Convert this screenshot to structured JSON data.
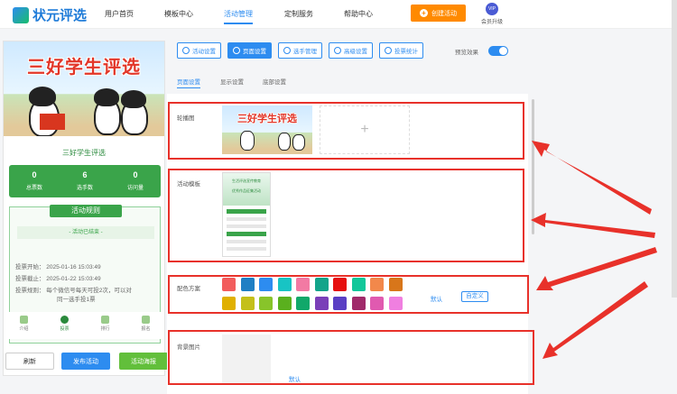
{
  "brand": {
    "name": "状元评选"
  },
  "nav": {
    "items": [
      "用户首页",
      "模板中心",
      "活动管理",
      "定制服务",
      "帮助中心"
    ],
    "active": "活动管理"
  },
  "header": {
    "create_button": "创建活动",
    "vip_badge": "VIP",
    "vip_label": "会员升级"
  },
  "phone": {
    "banner_title": "三好学生评选",
    "activity_name": "三好学生评选",
    "stats": [
      {
        "num": "0",
        "label": "总票数"
      },
      {
        "num": "6",
        "label": "选手数"
      },
      {
        "num": "0",
        "label": "访问量"
      }
    ],
    "rules_title": "活动规则",
    "ended": "- 活动已结束 -",
    "rule_start": "投票开始：  2025-01-16 15:03:49",
    "rule_end": "投票截止：  2025-01-22 15:03:49",
    "rule_desc1": "投票规则：  每个微信号每天可投2次，可以对",
    "rule_desc2": "同一选手投1票",
    "bottom_nav": [
      "介绍",
      "投票",
      "排行",
      "报名"
    ]
  },
  "actions": {
    "refresh": "刷新",
    "publish": "发布活动",
    "poster": "活动海报"
  },
  "toolbar": {
    "buttons": [
      "活动设置",
      "页面设置",
      "选手管理",
      "高级设置",
      "投票统计"
    ],
    "active": "页面设置",
    "preview_label": "预览效果",
    "preview_on": true
  },
  "tabs": {
    "items": [
      "页面设置",
      "显示设置",
      "底部设置"
    ],
    "active": "页面设置"
  },
  "sections": {
    "carousel_label": "轮播图",
    "carousel_thumb_title": "三好学生评选",
    "upload_plus": "+",
    "template_label": "活动模板",
    "template_thumb_title1": "生活评选宣传教育",
    "template_thumb_title2": "优秀作品征集活动",
    "color_label": "配色方案",
    "color_default": "默认",
    "color_custom": "自定义",
    "bg_label": "背景图片",
    "bg_default": "默认"
  },
  "colors": {
    "row1": [
      "#f25d5d",
      "#1f7fc4",
      "#2d8cf0",
      "#18c4c4",
      "#f27aa3",
      "#13a48a",
      "#e60f0f",
      "#11c79a",
      "#f2884b",
      "#d8761a"
    ],
    "row2": [
      "#e0b000",
      "#c4c01a",
      "#88c42a",
      "#5ab01e",
      "#11a86a",
      "#7a3fb8",
      "#5a3fc4",
      "#a02a6a",
      "#e05ab0",
      "#f07fe0"
    ],
    "accent": "#2d8cf0",
    "highlight": "#e8312a"
  }
}
